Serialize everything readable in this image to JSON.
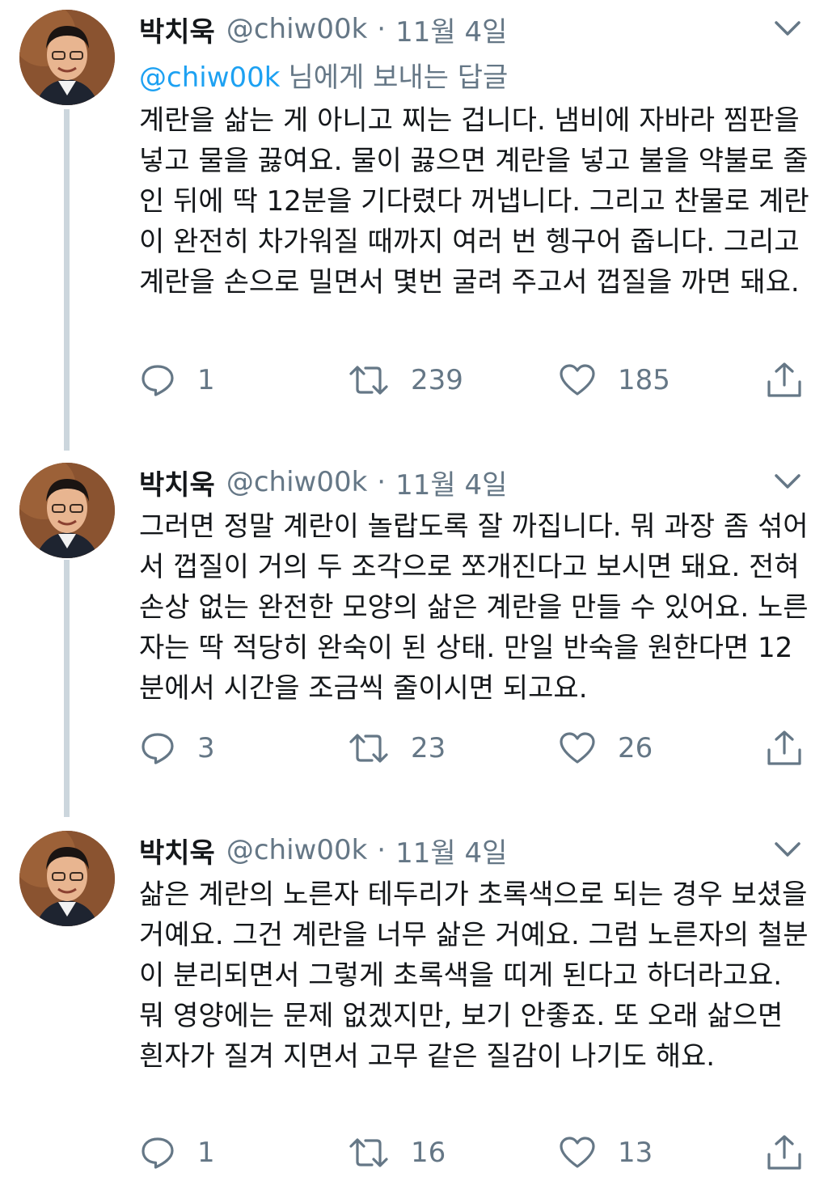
{
  "tweets": [
    {
      "author_name": "박치욱",
      "handle": "@chiw00k",
      "separator": "·",
      "date": "11월 4일",
      "reply_to_mention": "@chiw00k",
      "reply_to_suffix": "님에게 보내는 답글",
      "body": "계란을 삶는 게 아니고 찌는 겁니다. 냄비에 자바라 찜판을 넣고 물을 끓여요. 물이 끓으면 계란을 넣고 불을 약불로 줄인 뒤에 딱 12분을 기다렸다 꺼냅니다. 그리고 찬물로 계란이 완전히 차가워질 때까지 여러 번 헹구어 줍니다. 그리고 계란을 손으로 밀면서 몇번 굴려 주고서 껍질을 까면 돼요.",
      "replies": "1",
      "retweets": "239",
      "likes": "185"
    },
    {
      "author_name": "박치욱",
      "handle": "@chiw00k",
      "separator": "·",
      "date": "11월 4일",
      "body": "그러면 정말 계란이 놀랍도록 잘 까집니다. 뭐 과장 좀 섞어서 껍질이 거의 두 조각으로 쪼개진다고 보시면 돼요. 전혀 손상 없는 완전한 모양의 삶은 계란을 만들 수 있어요. 노른자는 딱 적당히 완숙이 된 상태. 만일 반숙을 원한다면 12분에서 시간을 조금씩 줄이시면 되고요.",
      "replies": "3",
      "retweets": "23",
      "likes": "26"
    },
    {
      "author_name": "박치욱",
      "handle": "@chiw00k",
      "separator": "·",
      "date": "11월 4일",
      "body": "삶은 계란의 노른자 테두리가 초록색으로 되는 경우 보셨을 거예요. 그건 계란을 너무 삶은 거예요. 그럼 노른자의 철분이 분리되면서 그렇게 초록색을 띠게 된다고 하더라고요. 뭐 영양에는 문제 없겠지만, 보기 안좋죠. 또 오래 삶으면 흰자가 질겨 지면서 고무 같은 질감이 나기도 해요.",
      "replies": "1",
      "retweets": "16",
      "likes": "13"
    }
  ],
  "icons": {
    "reply": "reply-icon",
    "retweet": "retweet-icon",
    "like": "heart-icon",
    "share": "share-icon",
    "more": "chevron-down-icon"
  },
  "colors": {
    "text": "#14171a",
    "secondary": "#657786",
    "link": "#1da1f2",
    "thread_line": "#ccd6dd"
  }
}
